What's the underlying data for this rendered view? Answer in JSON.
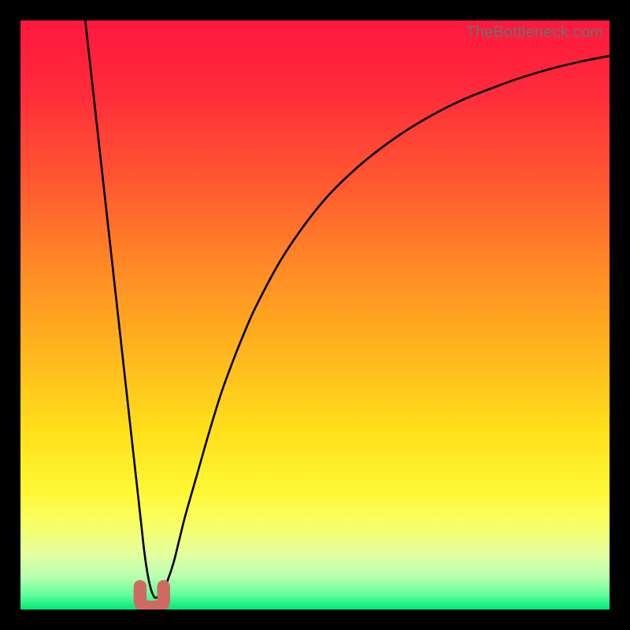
{
  "watermark": "TheBottleneck.com",
  "colors": {
    "gradient_stops": [
      {
        "offset": 0.0,
        "color": "#ff173e"
      },
      {
        "offset": 0.12,
        "color": "#ff2b3b"
      },
      {
        "offset": 0.28,
        "color": "#ff5a30"
      },
      {
        "offset": 0.42,
        "color": "#ff8a26"
      },
      {
        "offset": 0.56,
        "color": "#ffb51e"
      },
      {
        "offset": 0.7,
        "color": "#ffe01a"
      },
      {
        "offset": 0.8,
        "color": "#fff835"
      },
      {
        "offset": 0.86,
        "color": "#f6ff6a"
      },
      {
        "offset": 0.905,
        "color": "#e4ffa0"
      },
      {
        "offset": 0.945,
        "color": "#b6ffb0"
      },
      {
        "offset": 0.975,
        "color": "#62ff9c"
      },
      {
        "offset": 1.0,
        "color": "#00e874"
      }
    ],
    "curve": "#000000",
    "marker_fill": "#cf6a63",
    "marker_stroke": "#cf6a63"
  },
  "chart_data": {
    "type": "line",
    "title": "",
    "xlabel": "",
    "ylabel": "",
    "xlim": [
      0,
      100
    ],
    "ylim": [
      0,
      100
    ],
    "x": [
      11,
      12,
      13,
      14,
      15,
      16,
      17,
      18,
      19,
      19.5,
      20,
      20.5,
      21,
      21.5,
      22,
      22.5,
      23,
      24,
      25,
      26,
      27,
      28,
      30,
      32,
      34,
      36,
      38,
      40,
      44,
      48,
      52,
      56,
      60,
      65,
      70,
      75,
      80,
      85,
      90,
      95,
      100
    ],
    "values": [
      100,
      91,
      82,
      73,
      64,
      55,
      46,
      37,
      28,
      23.5,
      19,
      14.5,
      10,
      6.5,
      4,
      2.5,
      2,
      2.8,
      5,
      8,
      12,
      16,
      23,
      30,
      36.5,
      42,
      47,
      51.5,
      59,
      65,
      70,
      74,
      77.4,
      81,
      84,
      86.5,
      88.5,
      90.3,
      91.8,
      93,
      94
    ],
    "annotations": [
      {
        "type": "marker",
        "shape": "u",
        "x": 22.3,
        "y": 1.5
      }
    ]
  }
}
